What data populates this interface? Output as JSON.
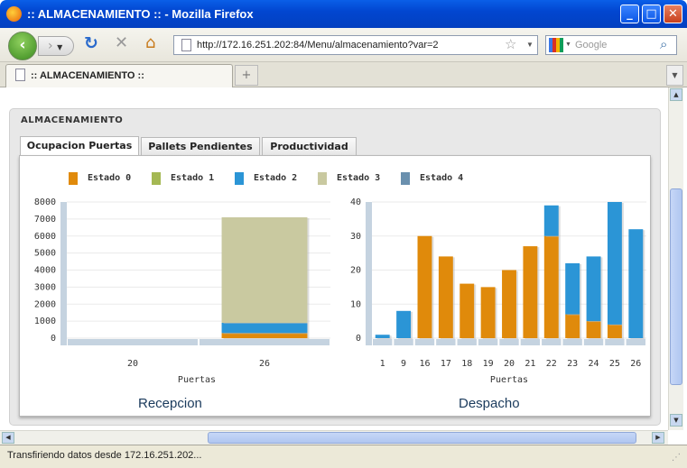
{
  "window": {
    "title": ":: ALMACENAMIENTO :: - Mozilla Firefox"
  },
  "browser": {
    "url": "http://172.16.251.202:84/Menu/almacenamiento?var=2",
    "search_placeholder": "Google",
    "tab_label": ":: ALMACENAMIENTO ::",
    "status": "Transfiriendo datos desde 172.16.251.202..."
  },
  "page": {
    "panel_title": "ALMACENAMIENTO",
    "tabs": [
      "Ocupacion Puertas",
      "Pallets Pendientes",
      "Productividad"
    ],
    "legend": [
      {
        "label": "Estado 0",
        "color": "#e08a0b"
      },
      {
        "label": "Estado 1",
        "color": "#a4b853"
      },
      {
        "label": "Estado 2",
        "color": "#2b95d6"
      },
      {
        "label": "Estado 3",
        "color": "#c9c9a0"
      },
      {
        "label": "Estado 4",
        "color": "#6a90ae"
      }
    ]
  },
  "chart_data": [
    {
      "type": "bar",
      "title": "Recepcion",
      "xlabel": "Puertas",
      "categories": [
        "20",
        "26"
      ],
      "ylim": [
        0,
        8000
      ],
      "yticks": [
        0,
        1000,
        2000,
        3000,
        4000,
        5000,
        6000,
        7000,
        8000
      ],
      "series": [
        {
          "name": "Estado 0",
          "values": [
            0,
            300
          ]
        },
        {
          "name": "Estado 2",
          "values": [
            0,
            600
          ]
        },
        {
          "name": "Estado 3",
          "values": [
            0,
            6200
          ]
        }
      ]
    },
    {
      "type": "bar",
      "title": "Despacho",
      "xlabel": "Puertas",
      "categories": [
        "1",
        "9",
        "16",
        "17",
        "18",
        "19",
        "20",
        "21",
        "22",
        "23",
        "24",
        "25",
        "26"
      ],
      "ylim": [
        0,
        40
      ],
      "yticks": [
        0,
        10,
        20,
        30,
        40
      ],
      "series": [
        {
          "name": "Estado 0",
          "values": [
            0,
            0,
            30,
            24,
            16,
            15,
            20,
            27,
            30,
            7,
            5,
            4,
            0
          ]
        },
        {
          "name": "Estado 2",
          "values": [
            1,
            8,
            0,
            0,
            0,
            0,
            0,
            0,
            9,
            15,
            19,
            36,
            32
          ]
        }
      ]
    }
  ]
}
